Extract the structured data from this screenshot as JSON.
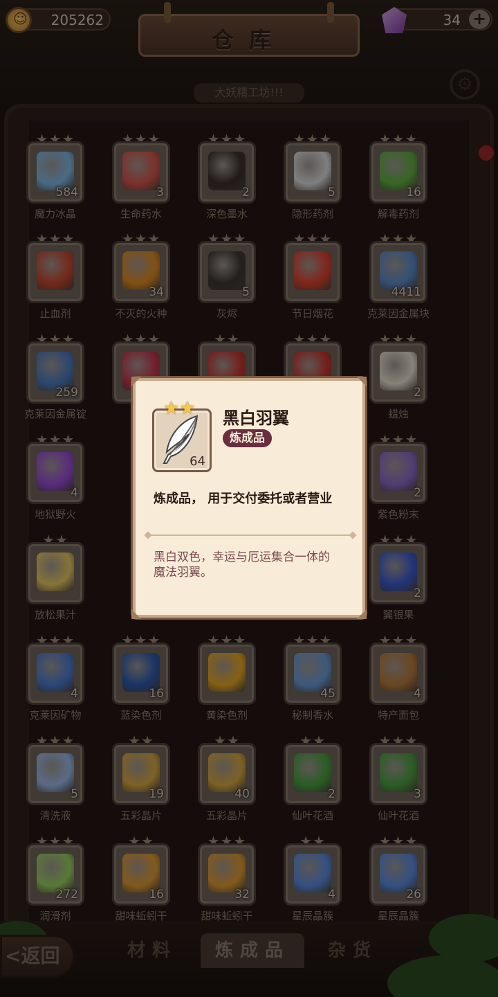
{
  "currency": {
    "coins": "205262",
    "gems": "34"
  },
  "header": {
    "title": "仓库",
    "subtitle": "大妖精工坊!!!"
  },
  "items": [
    {
      "name": "魔力冰晶",
      "count": "584",
      "stars": "★★★",
      "icon": "ice-crystal",
      "color": "#7fb8e8"
    },
    {
      "name": "生命药水",
      "count": "3",
      "stars": "★★★",
      "icon": "red-potion",
      "color": "#d8544a"
    },
    {
      "name": "深色墨水",
      "count": "2",
      "stars": "★★★",
      "icon": "ink-bottle",
      "color": "#3a2e2a"
    },
    {
      "name": "隐形药剂",
      "count": "5",
      "stars": "★★★",
      "icon": "white-bottles",
      "color": "#dcdcdc"
    },
    {
      "name": "解毒药剂",
      "count": "16",
      "stars": "★★★",
      "icon": "green-potion",
      "color": "#5fb040"
    },
    {
      "name": "止血剂",
      "count": "",
      "stars": "★★★",
      "icon": "red-gourd",
      "color": "#c8452e"
    },
    {
      "name": "不灭的火种",
      "count": "34",
      "stars": "★★★",
      "icon": "fire-ore",
      "color": "#e08a20"
    },
    {
      "name": "灰烬",
      "count": "5",
      "stars": "★★★",
      "icon": "ash",
      "color": "#3e3632"
    },
    {
      "name": "节日烟花",
      "count": "",
      "stars": "★★★",
      "icon": "firework",
      "color": "#e0402e"
    },
    {
      "name": "克莱因金属块",
      "count": "4411",
      "stars": "★★★",
      "icon": "metal-block",
      "color": "#5a8ac8"
    },
    {
      "name": "克莱因金属锭",
      "count": "259",
      "stars": "★★★",
      "icon": "metal-ingot",
      "color": "#4a7ac0"
    },
    {
      "name": "",
      "count": "",
      "stars": "★★★",
      "icon": "red-gem",
      "color": "#c8344e"
    },
    {
      "name": "",
      "count": "",
      "stars": "★★",
      "icon": "red-flower",
      "color": "#c8342e"
    },
    {
      "name": "",
      "count": "",
      "stars": "★★★",
      "icon": "red-flower",
      "color": "#c8342e"
    },
    {
      "name": "蜡烛",
      "count": "2",
      "stars": "★★★",
      "icon": "candle",
      "color": "#e8e0d0"
    },
    {
      "name": "地狱野火",
      "count": "4",
      "stars": "★★★",
      "icon": "purple-flame",
      "color": "#9a4ad8"
    },
    {
      "name": "",
      "count": "",
      "stars": "",
      "icon": "",
      "color": ""
    },
    {
      "name": "",
      "count": "",
      "stars": "",
      "icon": "",
      "color": ""
    },
    {
      "name": "",
      "count": "",
      "stars": "",
      "icon": "",
      "color": ""
    },
    {
      "name": "紫色粉末",
      "count": "2",
      "stars": "★★★",
      "icon": "purple-powder",
      "color": "#8a6ac8"
    },
    {
      "name": "放松果汁",
      "count": "",
      "stars": "★★",
      "icon": "juice",
      "color": "#e8c860"
    },
    {
      "name": "",
      "count": "",
      "stars": "",
      "icon": "",
      "color": ""
    },
    {
      "name": "",
      "count": "",
      "stars": "",
      "icon": "",
      "color": ""
    },
    {
      "name": "",
      "count": "",
      "stars": "",
      "icon": "",
      "color": ""
    },
    {
      "name": "翼银果",
      "count": "2",
      "stars": "★★★",
      "icon": "berry",
      "color": "#3a5ad0"
    },
    {
      "name": "克莱因矿物",
      "count": "4",
      "stars": "★★★",
      "icon": "mineral",
      "color": "#4a7ad0"
    },
    {
      "name": "蓝染色剂",
      "count": "16",
      "stars": "★★★",
      "icon": "blue-dye",
      "color": "#2a5ab0"
    },
    {
      "name": "黄染色剂",
      "count": "",
      "stars": "★★★",
      "icon": "yellow-dye",
      "color": "#e8a820"
    },
    {
      "name": "秘制香水",
      "count": "45",
      "stars": "★★★",
      "icon": "perfume",
      "color": "#6a9ad8"
    },
    {
      "name": "特产面包",
      "count": "4",
      "stars": "★★★",
      "icon": "bread",
      "color": "#b87a3a"
    },
    {
      "name": "清洗液",
      "count": "5",
      "stars": "★★★",
      "icon": "snowflakes",
      "color": "#9ab8e8"
    },
    {
      "name": "五彩晶片",
      "count": "19",
      "stars": "★★",
      "icon": "mirror",
      "color": "#d8a840"
    },
    {
      "name": "五彩晶片",
      "count": "40",
      "stars": "★★",
      "icon": "mirror",
      "color": "#d8a840"
    },
    {
      "name": "仙叶花酒",
      "count": "2",
      "stars": "★★",
      "icon": "leaf-wine",
      "color": "#4aa040"
    },
    {
      "name": "仙叶花酒",
      "count": "3",
      "stars": "★★★",
      "icon": "leaf-wine",
      "color": "#4aa040"
    },
    {
      "name": "润滑剂",
      "count": "272",
      "stars": "★★★",
      "icon": "green-bowl",
      "color": "#9ad060"
    },
    {
      "name": "甜味蚯蚓干",
      "count": "16",
      "stars": "★★",
      "icon": "sandals",
      "color": "#e09a30"
    },
    {
      "name": "甜味蚯蚓干",
      "count": "32",
      "stars": "★★★",
      "icon": "sandals",
      "color": "#e09a30"
    },
    {
      "name": "星辰晶簇",
      "count": "4",
      "stars": "★★",
      "icon": "crystal-cluster",
      "color": "#5a8ae0"
    },
    {
      "name": "星辰晶簇",
      "count": "26",
      "stars": "★★★",
      "icon": "crystal-cluster",
      "color": "#5a8ae0"
    }
  ],
  "tabs": {
    "materials": "材料",
    "alchemy": "炼成品",
    "misc": "杂货"
  },
  "back": {
    "label": "返回"
  },
  "popup": {
    "stars": "★★",
    "title": "黑白羽翼",
    "category": "炼成品",
    "count": "64",
    "usage": "炼成品， 用于交付委托或者营业",
    "description": "黑白双色，幸运与厄运集合一体的魔法羽翼。"
  }
}
